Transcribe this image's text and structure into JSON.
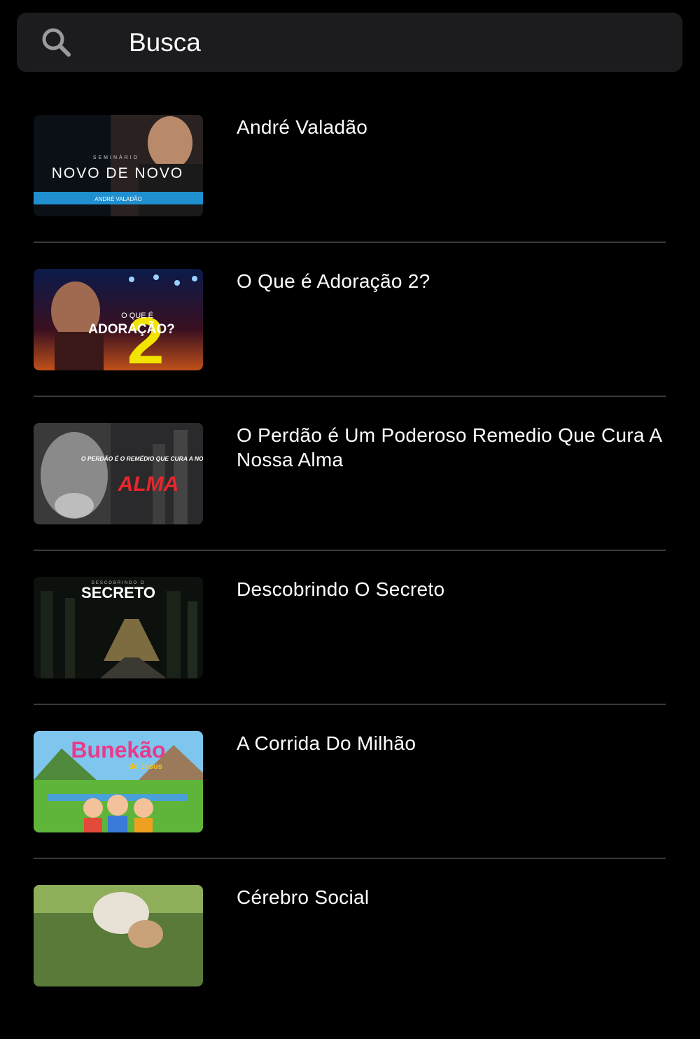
{
  "search": {
    "placeholder": "Busca",
    "icon": "search-icon"
  },
  "results": [
    {
      "title": "André Valadão",
      "thumb_text": "NOVO DE NOVO",
      "thumb_sub": "ANDRÉ VALADÃO",
      "thumb_top": "SEMINÁRIO"
    },
    {
      "title": "O Que é Adoração 2?",
      "thumb_text": "ADORAÇÃO?",
      "thumb_sub": "O QUE É",
      "thumb_num": "2"
    },
    {
      "title": "O Perdão é Um Poderoso Remedio Que Cura A Nossa Alma",
      "thumb_text": "ALMA",
      "thumb_sub": "O PERDÃO É O REMÉDIO QUE CURA A NOSSA"
    },
    {
      "title": "Descobrindo O Secreto",
      "thumb_text": "SECRETO",
      "thumb_sub": "DESCOBRINDO O"
    },
    {
      "title": "A Corrida Do Milhão",
      "thumb_text": "Bunekão",
      "thumb_sub": "do Jesus"
    },
    {
      "title": "Cérebro Social"
    }
  ],
  "colors": {
    "background": "#000000",
    "search_bg": "#1c1c1e",
    "divider": "#3a3a3c",
    "text": "#ffffff"
  }
}
